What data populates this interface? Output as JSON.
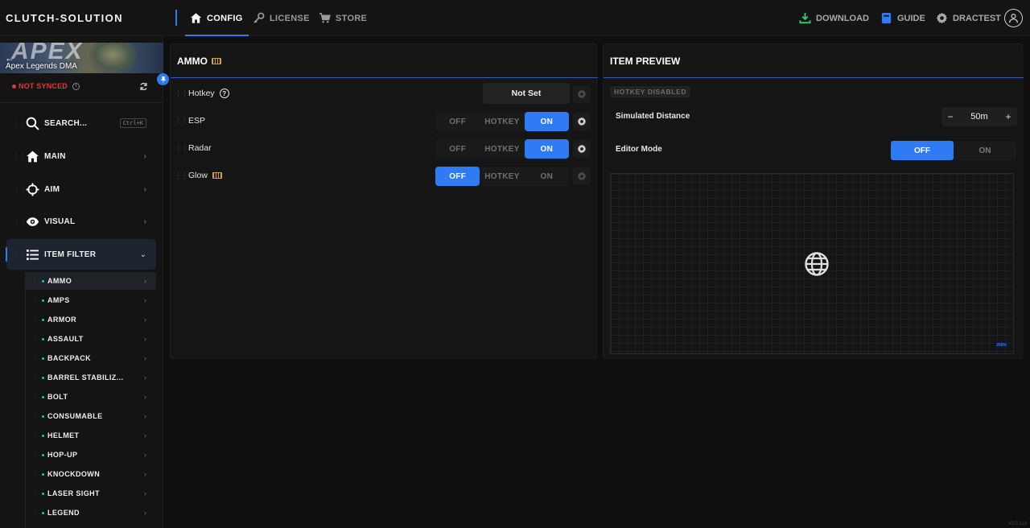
{
  "app": {
    "brand": "CLUTCH-SOLUTION",
    "version": "v3.0.113"
  },
  "nav": {
    "tabs": [
      {
        "label": "CONFIG",
        "icon": "home-icon"
      },
      {
        "label": "LICENSE",
        "icon": "key-icon"
      },
      {
        "label": "STORE",
        "icon": "cart-icon"
      }
    ],
    "right": [
      {
        "label": "DOWNLOAD",
        "icon": "download-icon"
      },
      {
        "label": "GUIDE",
        "icon": "book-icon"
      },
      {
        "label": "DRACTEST",
        "icon": "gear-icon"
      }
    ]
  },
  "sidebar": {
    "banner_caption": "Apex Legends DMA",
    "banner_logo": "APEX",
    "sync_status": "NOT SYNCED",
    "search_label": "SEARCH...",
    "search_shortcut": "Ctrl+K",
    "menu": [
      {
        "label": "MAIN",
        "icon": "home-icon"
      },
      {
        "label": "AIM",
        "icon": "crosshair-icon"
      },
      {
        "label": "VISUAL",
        "icon": "eye-icon"
      },
      {
        "label": "ITEM FILTER",
        "icon": "list-icon"
      }
    ],
    "subitems": [
      "AMMO",
      "AMPS",
      "ARMOR",
      "ASSAULT",
      "BACKPACK",
      "BARREL STABILIZ...",
      "BOLT",
      "CONSUMABLE",
      "HELMET",
      "HOP-UP",
      "KNOCKDOWN",
      "LASER SIGHT",
      "LEGEND"
    ],
    "active_subitem": "AMMO"
  },
  "ammo_panel": {
    "title": "AMMO",
    "hotkey": {
      "label": "Hotkey",
      "value": "Not Set"
    },
    "options": {
      "off": "OFF",
      "hotkey": "HOTKEY",
      "on": "ON"
    },
    "rows": [
      {
        "label": "ESP",
        "state": "on"
      },
      {
        "label": "Radar",
        "state": "on"
      },
      {
        "label": "Glow",
        "state": "off"
      }
    ]
  },
  "preview_panel": {
    "title": "ITEM PREVIEW",
    "badge": "HOTKEY DISABLED",
    "distance_label": "Simulated Distance",
    "distance_value": "50m",
    "minus": "−",
    "plus": "+",
    "editor_label": "Editor Mode",
    "editor_off": "OFF",
    "editor_on": "ON",
    "editor_state": "off",
    "zoom_label": "200%"
  },
  "colors": {
    "accent": "#2f7bf5",
    "warning": "#e0393e",
    "status_ok": "#2ecc71"
  }
}
